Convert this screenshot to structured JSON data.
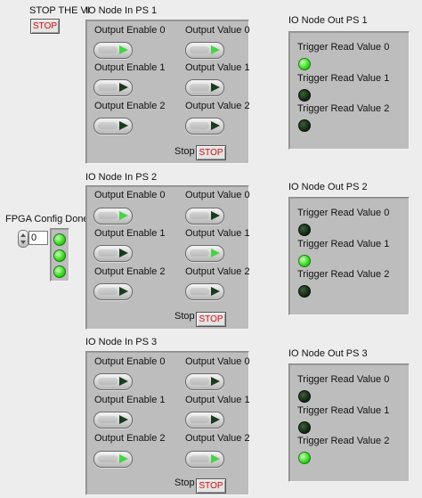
{
  "stop_vi": {
    "label": "STOP THE VI",
    "button": "STOP"
  },
  "fpga": {
    "label": "FPGA Config Done",
    "index": "0",
    "leds": [
      true,
      true,
      true
    ]
  },
  "in_panels": [
    {
      "title": "IO Node In PS 1",
      "enable_labels": [
        "Output Enable 0",
        "Output Enable 1",
        "Output Enable 2"
      ],
      "value_labels": [
        "Output Value 0",
        "Output Value 1",
        "Output Value 2"
      ],
      "enable_states": [
        true,
        false,
        false
      ],
      "value_states": [
        true,
        false,
        false
      ],
      "stop_label": "Stop",
      "stop_button": "STOP"
    },
    {
      "title": "IO Node In PS 2",
      "enable_labels": [
        "Output Enable 0",
        "Output Enable 1",
        "Output Enable 2"
      ],
      "value_labels": [
        "Output Value 0",
        "Output Value 1",
        "Output Value 2"
      ],
      "enable_states": [
        true,
        false,
        false
      ],
      "value_states": [
        false,
        true,
        false
      ],
      "stop_label": "Stop",
      "stop_button": "STOP"
    },
    {
      "title": "IO Node In PS 3",
      "enable_labels": [
        "Output Enable 0",
        "Output Enable 1",
        "Output Enable 2"
      ],
      "value_labels": [
        "Output Value 0",
        "Output Value 1",
        "Output Value 2"
      ],
      "enable_states": [
        false,
        false,
        true
      ],
      "value_states": [
        false,
        false,
        true
      ],
      "stop_label": "Stop",
      "stop_button": "STOP"
    }
  ],
  "out_panels": [
    {
      "title": "IO Node Out PS 1",
      "labels": [
        "Trigger Read Value 0",
        "Trigger Read Value 1",
        "Trigger Read Value 2"
      ],
      "states": [
        true,
        false,
        false
      ]
    },
    {
      "title": "IO Node Out PS 2",
      "labels": [
        "Trigger Read Value 0",
        "Trigger Read Value 1",
        "Trigger Read Value 2"
      ],
      "states": [
        false,
        true,
        false
      ]
    },
    {
      "title": "IO Node Out PS 3",
      "labels": [
        "Trigger Read Value 0",
        "Trigger Read Value 1",
        "Trigger Read Value 2"
      ],
      "states": [
        false,
        false,
        true
      ]
    }
  ]
}
